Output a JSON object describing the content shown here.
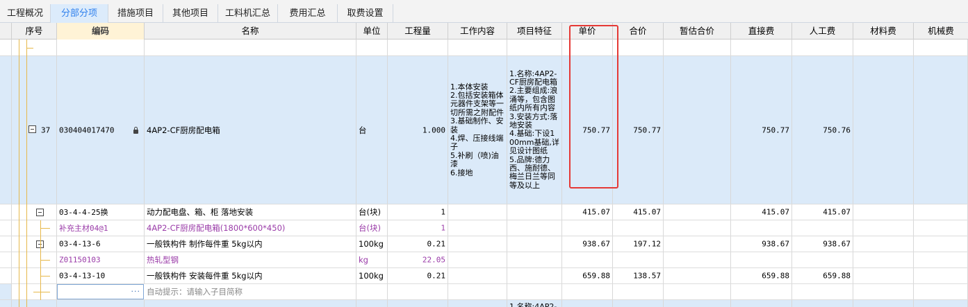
{
  "tabs": [
    "工程概况",
    "分部分项",
    "措施项目",
    "其他项目",
    "工料机汇总",
    "费用汇总",
    "取费设置"
  ],
  "active_tab": "分部分项",
  "columns": {
    "seq": "序号",
    "code": "编码",
    "name": "名称",
    "unit": "单位",
    "qty": "工程量",
    "work": "工作内容",
    "feature": "项目特征",
    "unit_price": "单价",
    "total": "合价",
    "prov_total": "暂估合价",
    "direct": "直接费",
    "labor": "人工费",
    "material": "材料费",
    "machine": "机械费"
  },
  "rows": [
    {
      "seq": "37",
      "code": "030404017470",
      "locked": true,
      "name": "4AP2-CF厨房配电箱",
      "unit": "台",
      "qty": "1.000",
      "work": "1.本体安装\n2.包括安装箱体元器件支架等一切所需之附配件\n3.基础制作、安装\n4.焊、压接线端子\n5.补刷（喷)油漆\n6.接地",
      "feature": "1.名称:4AP2-CF厨房配电箱\n2.主要组成:浪涌等，包含图纸内所有内容\n3.安装方式:落地安装\n4.基础:下设100mm基础,详见设计图纸\n5.品牌:德力西、施耐德、梅兰日兰等同等及以上",
      "unit_price": "750.77",
      "total": "750.77",
      "prov_total": "",
      "direct": "750.77",
      "labor": "750.76",
      "material": "",
      "machine": ""
    },
    {
      "seq": "",
      "code": "03-4-4-25换",
      "name": "动力配电盘、箱、柜 落地安装",
      "unit": "台(块)",
      "qty": "1",
      "unit_price": "415.07",
      "total": "415.07",
      "direct": "415.07",
      "labor": "415.07"
    },
    {
      "seq": "",
      "code": "补充主材04@1",
      "name": "4AP2-CF厨房配电箱(1800*600*450)",
      "unit": "台(块)",
      "qty": "1",
      "unit_price": "",
      "total": "",
      "direct": "",
      "labor": ""
    },
    {
      "seq": "",
      "code": "03-4-13-6",
      "name": "一般铁构件 制作每件重 5kg以内",
      "unit": "100kg",
      "qty": "0.21",
      "unit_price": "938.67",
      "total": "197.12",
      "direct": "938.67",
      "labor": "938.67"
    },
    {
      "seq": "",
      "code": "Z01150103",
      "name": "热轧型钢",
      "unit": "kg",
      "qty": "22.05",
      "unit_price": "",
      "total": "",
      "direct": "",
      "labor": ""
    },
    {
      "seq": "",
      "code": "03-4-13-10",
      "name": "一般铁构件 安装每件重 5kg以内",
      "unit": "100kg",
      "qty": "0.21",
      "unit_price": "659.88",
      "total": "138.57",
      "direct": "659.88",
      "labor": "659.88"
    },
    {
      "seq": "",
      "code": "",
      "name_hint": "自动提示：请输入子目简称",
      "edit_button": "···"
    }
  ],
  "next_row_feature_partial": "1.名称:4AP2-"
}
